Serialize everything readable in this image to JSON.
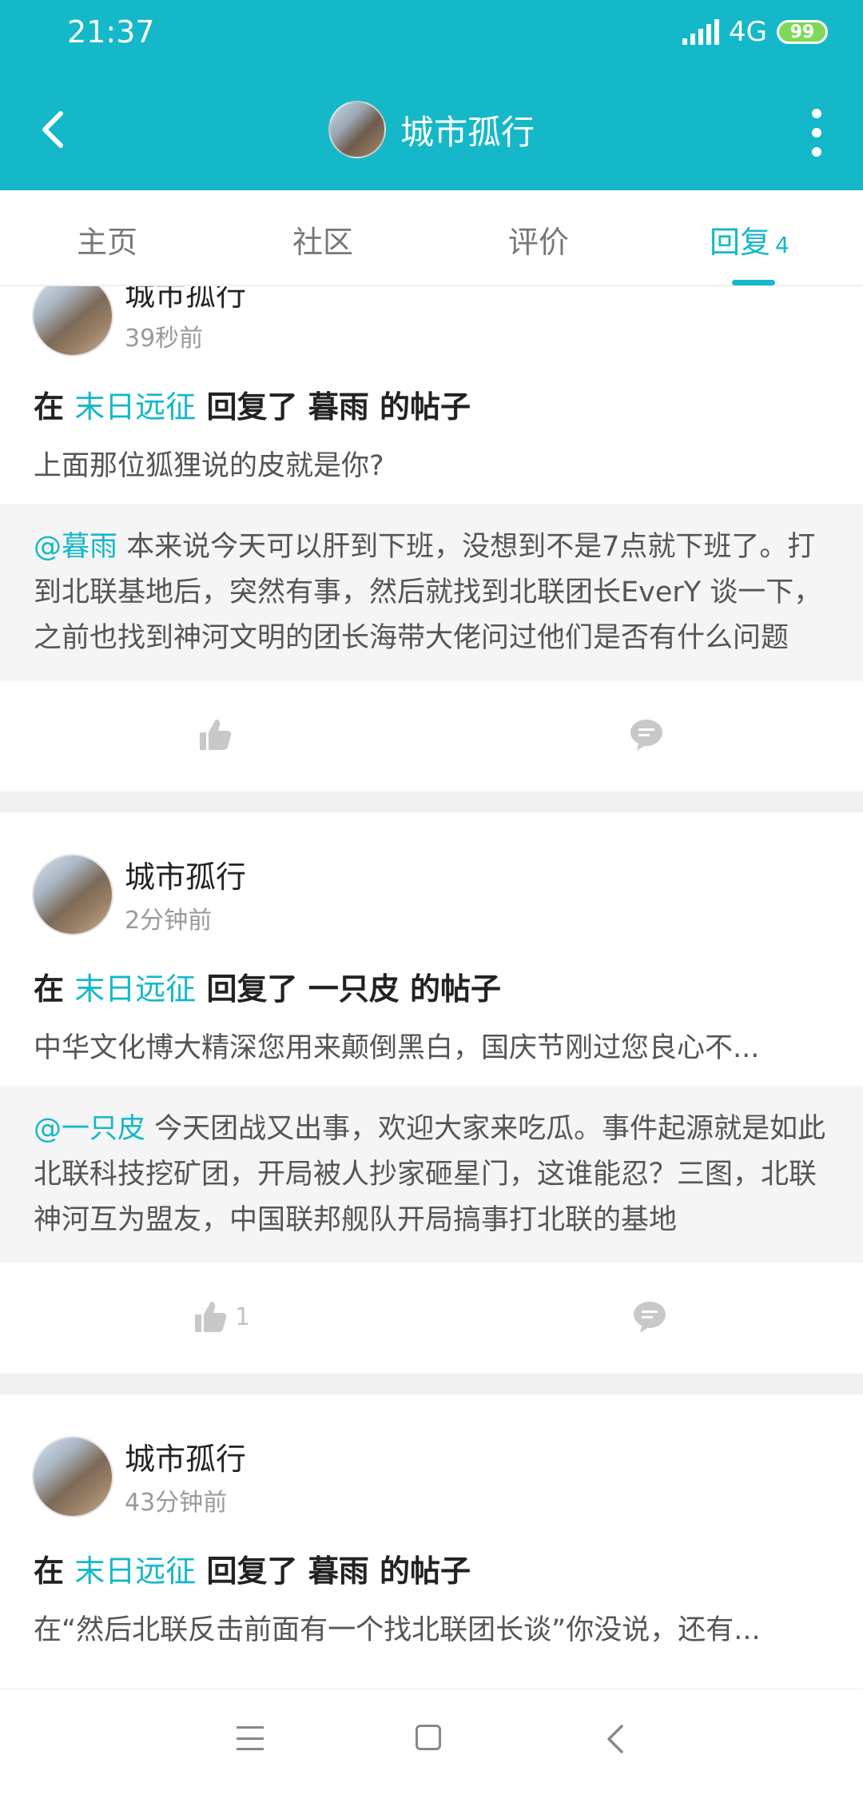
{
  "status_bar": {
    "time": "21:37",
    "network": "4G",
    "battery": "99"
  },
  "header": {
    "title": "城市孤行"
  },
  "tabs": [
    {
      "label": "主页"
    },
    {
      "label": "社区"
    },
    {
      "label": "评价"
    },
    {
      "label": "回复",
      "count": "4"
    }
  ],
  "posts": [
    {
      "user": "城市孤行",
      "time": "39秒前",
      "headline": {
        "prefix": "在",
        "game": "末日远征",
        "middle": "回复了",
        "target_user": "暮雨",
        "suffix": "的帖子"
      },
      "body": "上面那位狐狸说的皮就是你?",
      "quote": {
        "mention": "@暮雨",
        "text": " 本来说今天可以肝到下班，没想到不是7点就下班了。打到北联基地后，突然有事，然后就找到北联团长EverY 谈一下，之前也找到神河文明的团长海带大佬问过他们是否有什么问题"
      },
      "likes": ""
    },
    {
      "user": "城市孤行",
      "time": "2分钟前",
      "headline": {
        "prefix": "在",
        "game": "末日远征",
        "middle": "回复了",
        "target_user": "一只皮",
        "suffix": "的帖子"
      },
      "body": "中华文化博大精深您用来颠倒黑白，国庆节刚过您良心不...",
      "quote": {
        "mention": "@一只皮",
        "text": " 今天团战又出事，欢迎大家来吃瓜。事件起源就是如此北联科技挖矿团，开局被人抄家砸星门，这谁能忍？三图，北联神河互为盟友，中国联邦舰队开局搞事打北联的基地"
      },
      "likes": "1"
    },
    {
      "user": "城市孤行",
      "time": "43分钟前",
      "headline": {
        "prefix": "在",
        "game": "末日远征",
        "middle": "回复了",
        "target_user": "暮雨",
        "suffix": "的帖子"
      },
      "body": "在“然后北联反击前面有一个找北联团长谈”你没说，还有..."
    }
  ],
  "colors": {
    "accent": "#15b8c8",
    "background": "#f0f0f0"
  },
  "icons": [
    "back-arrow-icon",
    "more-vertical-icon",
    "thumbs-up-icon",
    "comment-icon",
    "menu-icon",
    "home-square-icon",
    "back-chevron-icon"
  ]
}
